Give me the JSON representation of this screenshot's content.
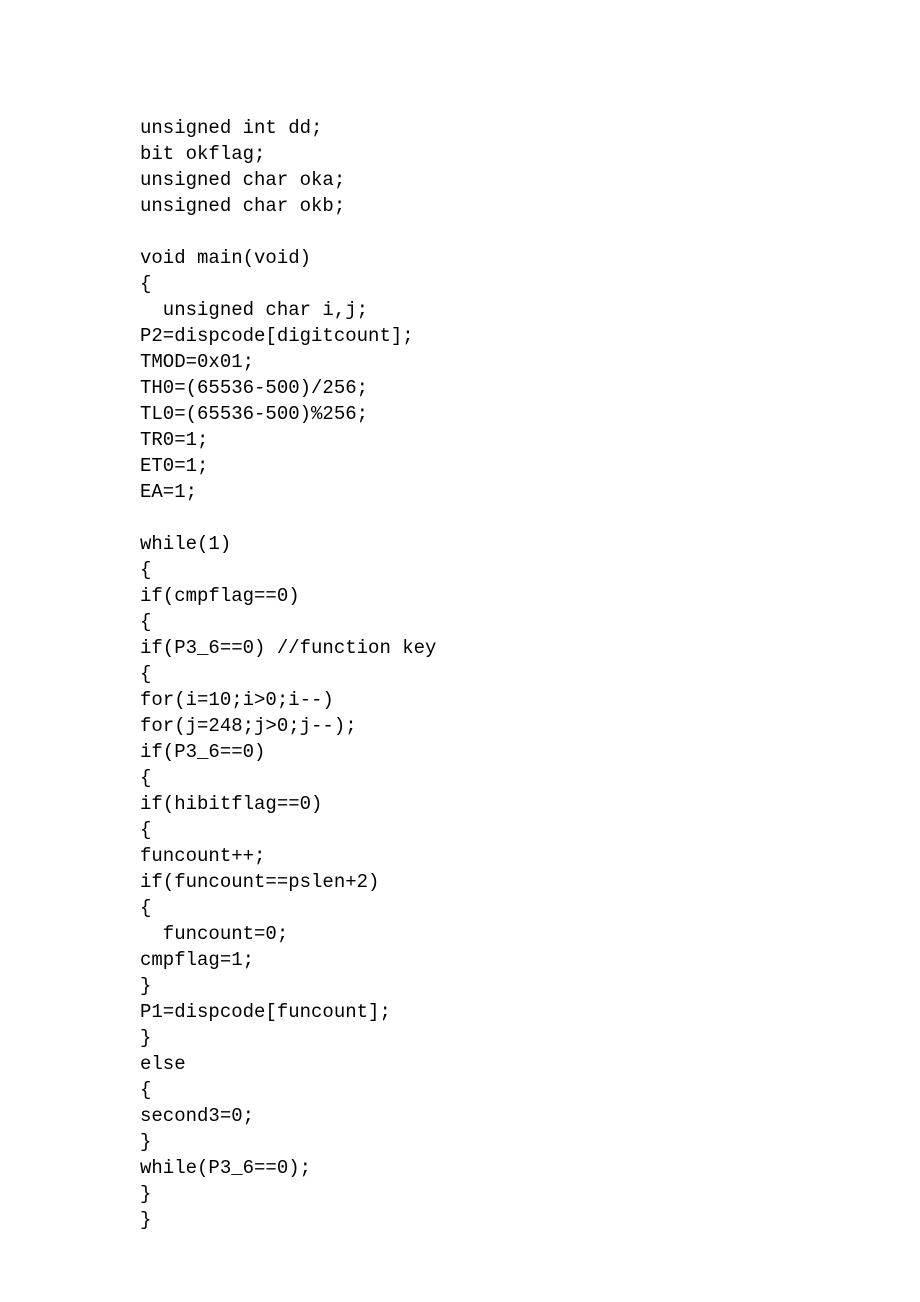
{
  "code": {
    "lines": [
      "unsigned int dd;",
      "bit okflag;",
      "unsigned char oka;",
      "unsigned char okb;",
      "",
      "void main(void)",
      "{",
      "  unsigned char i,j;",
      "P2=dispcode[digitcount];",
      "TMOD=0x01;",
      "TH0=(65536-500)/256;",
      "TL0=(65536-500)%256;",
      "TR0=1;",
      "ET0=1;",
      "EA=1;",
      "",
      "while(1)",
      "{",
      "if(cmpflag==0)",
      "{",
      "if(P3_6==0) //function key",
      "{",
      "for(i=10;i>0;i--)",
      "for(j=248;j>0;j--);",
      "if(P3_6==0)",
      "{",
      "if(hibitflag==0)",
      "{",
      "funcount++;",
      "if(funcount==pslen+2)",
      "{",
      "  funcount=0;",
      "cmpflag=1;",
      "}",
      "P1=dispcode[funcount];",
      "}",
      "else",
      "{",
      "second3=0;",
      "}",
      "while(P3_6==0);",
      "}",
      "}"
    ]
  }
}
